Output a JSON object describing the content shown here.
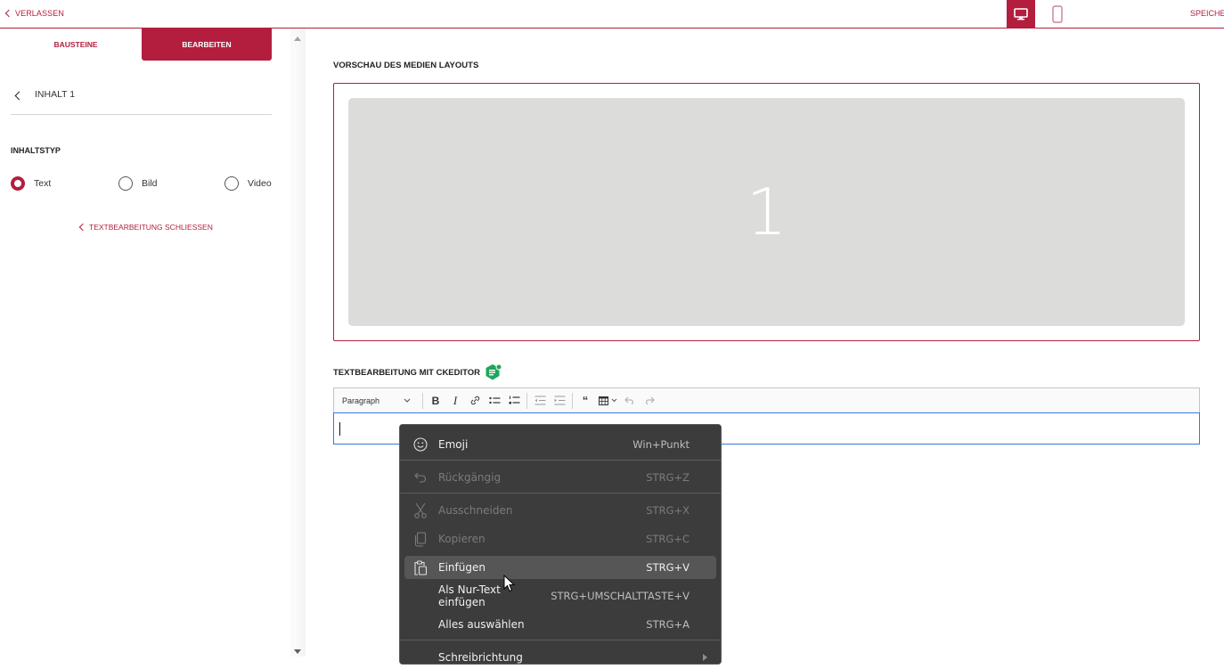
{
  "topbar": {
    "leave_label": "VERLASSEN",
    "save_label": "SPEICHERN",
    "devices": [
      {
        "name": "desktop",
        "icon": "monitor-icon",
        "active": true
      },
      {
        "name": "mobile",
        "icon": "smartphone-icon",
        "active": false
      }
    ]
  },
  "sidebar": {
    "tabs": [
      {
        "label": "BAUSTEINE",
        "active": false
      },
      {
        "label": "BEARBEITEN",
        "active": true
      }
    ],
    "content_title": "INHALT 1",
    "content_type_label": "INHALTSTYP",
    "content_types": [
      {
        "label": "Text",
        "selected": true
      },
      {
        "label": "Bild",
        "selected": false
      },
      {
        "label": "Video",
        "selected": false
      }
    ],
    "close_edit_label": "TEXTBEARBEITUNG SCHLIESSEN"
  },
  "main": {
    "preview_title": "VORSCHAU DES MEDIEN LAYOUTS",
    "preview_slots": [
      {
        "number": "1"
      }
    ],
    "ckeditor_title": "TEXTBEARBEITUNG MIT CKEDITOR",
    "toolbar": {
      "heading_select": "Paragraph",
      "buttons": [
        "bold",
        "italic",
        "link",
        "bulleted-list",
        "numbered-list",
        "outdent",
        "indent",
        "block-quote",
        "insert-table",
        "undo",
        "redo"
      ]
    },
    "editor_content": ""
  },
  "context_menu": {
    "items": [
      {
        "label": "Emoji",
        "shortcut": "Win+Punkt",
        "icon": "emoji-icon",
        "disabled": false
      },
      {
        "label": "Rückgängig",
        "shortcut": "STRG+Z",
        "icon": "undo-icon",
        "disabled": true
      },
      {
        "label": "Ausschneiden",
        "shortcut": "STRG+X",
        "icon": "scissors-icon",
        "disabled": true
      },
      {
        "label": "Kopieren",
        "shortcut": "STRG+C",
        "icon": "copy-icon",
        "disabled": true
      },
      {
        "label": "Einfügen",
        "shortcut": "STRG+V",
        "icon": "paste-icon",
        "disabled": false,
        "hovered": true
      },
      {
        "label": "Als Nur-Text einfügen",
        "shortcut": "STRG+UMSCHALTTASTE+V",
        "icon": "",
        "disabled": false
      },
      {
        "label": "Alles auswählen",
        "shortcut": "STRG+A",
        "icon": "",
        "disabled": false
      },
      {
        "label": "Schreibrichtung",
        "shortcut": "",
        "icon": "",
        "disabled": false,
        "submenu": true
      }
    ]
  }
}
